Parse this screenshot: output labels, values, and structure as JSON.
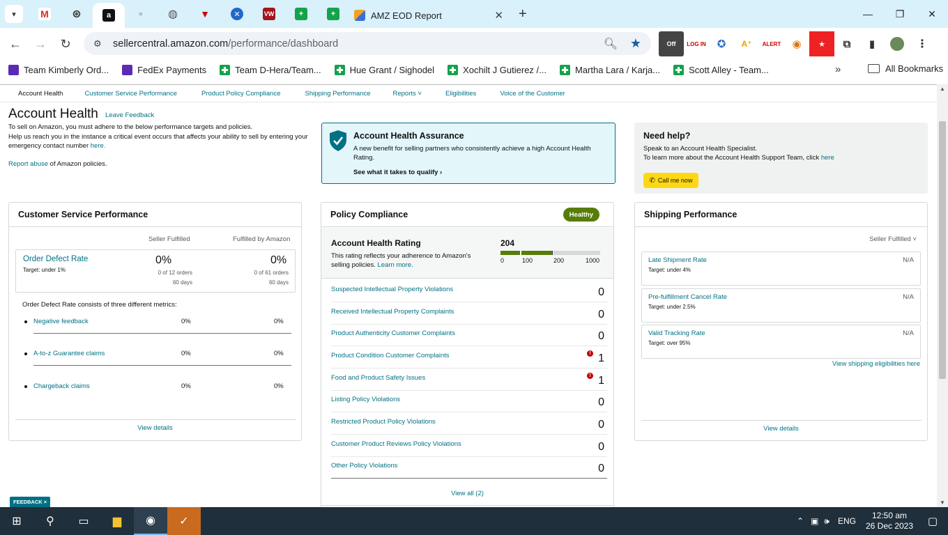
{
  "browser": {
    "active_tab_title": "AMZ EOD Report",
    "url_host": "sellercentral.amazon.com",
    "url_path": "/performance/dashboard",
    "bookmarks": [
      "Team Kimberly Ord...",
      "FedEx Payments",
      "Team D-Hera/Team...",
      "Hue Grant / Sighodel",
      "Xochilt J Gutierez /...",
      "Martha Lara / Karja...",
      "Scott Alley - Team..."
    ],
    "all_bookmarks": "All Bookmarks"
  },
  "subnav": [
    "Account Health",
    "Customer Service Performance",
    "Product Policy Compliance",
    "Shipping Performance",
    "Reports ˅",
    "Eligibilities",
    "Voice of the Customer"
  ],
  "account_health": {
    "title": "Account Health",
    "leave_feedback": "Leave Feedback",
    "desc1": "To sell on Amazon, you must adhere to the below performance targets and policies.",
    "desc2": "Help us reach you in the instance a critical event occurs that affects your ability to sell by entering your emergency contact number",
    "here": "here.",
    "report_abuse": "Report abuse",
    "report_rest": " of Amazon policies."
  },
  "assurance": {
    "title": "Account Health Assurance",
    "desc": "A new benefit for selling partners who consistently achieve a high Account Health Rating.",
    "link": "See what it takes to qualify ›"
  },
  "help": {
    "title": "Need help?",
    "line1": "Speak to an Account Health Specialist.",
    "line2": "To learn more about the Account Health Support Team, click",
    "here": "here",
    "button": "Call me now"
  },
  "csp": {
    "title": "Customer Service Performance",
    "col1": "Seller Fulfilled",
    "col2": "Fulfilled by Amazon",
    "odr_title": "Order Defect Rate",
    "odr_target": "Target: under 1%",
    "sf_value": "0%",
    "sf_orders": "0 of 12 orders",
    "sf_days": "60 days",
    "fba_value": "0%",
    "fba_orders": "0 of 61 orders",
    "fba_days": "60 days",
    "consists": "Order Defect Rate consists of three different metrics:",
    "metrics": [
      {
        "name": "Negative feedback",
        "sf": "0%",
        "fba": "0%"
      },
      {
        "name": "A-to-z Guarantee claims",
        "sf": "0%",
        "fba": "0%"
      },
      {
        "name": "Chargeback claims",
        "sf": "0%",
        "fba": "0%"
      }
    ],
    "footer": "View details"
  },
  "policy": {
    "title": "Policy Compliance",
    "badge": "Healthy",
    "ahr_title": "Account Health Rating",
    "ahr_desc": "This rating reflects your adherence to Amazon's selling policies.",
    "learn_more": "Learn more.",
    "ahr_value": "204",
    "ahr_ticks": [
      "0",
      "100",
      "200",
      "1000"
    ],
    "rows": [
      {
        "name": "Suspected Intellectual Property Violations",
        "value": "0",
        "alert": false
      },
      {
        "name": "Received Intellectual Property Complaints",
        "value": "0",
        "alert": false
      },
      {
        "name": "Product Authenticity Customer Complaints",
        "value": "0",
        "alert": false
      },
      {
        "name": "Product Condition Customer Complaints",
        "value": "1",
        "alert": true
      },
      {
        "name": "Food and Product Safety Issues",
        "value": "1",
        "alert": true
      },
      {
        "name": "Listing Policy Violations",
        "value": "0",
        "alert": false
      },
      {
        "name": "Restricted Product Policy Violations",
        "value": "0",
        "alert": false
      },
      {
        "name": "Customer Product Reviews Policy Violations",
        "value": "0",
        "alert": false
      },
      {
        "name": "Other Policy Violations",
        "value": "0",
        "alert": false
      }
    ],
    "footer": "View all (2)"
  },
  "shipping": {
    "title": "Shipping Performance",
    "selector": "Seller Fulfilled ˅",
    "items": [
      {
        "name": "Late Shipment Rate",
        "target": "Target: under 4%",
        "value": "N/A"
      },
      {
        "name": "Pre-fulfillment Cancel Rate",
        "target": "Target: under 2.5%",
        "value": "N/A"
      },
      {
        "name": "Valid Tracking Rate",
        "target": "Target: over 95%",
        "value": "N/A"
      }
    ],
    "eligibility": "View shipping eligibilities here",
    "footer": "View details"
  },
  "feedback_tab": "FEEDBACK ×",
  "taskbar": {
    "lang": "ENG",
    "time": "12:50 am",
    "date": "26 Dec 2023"
  }
}
